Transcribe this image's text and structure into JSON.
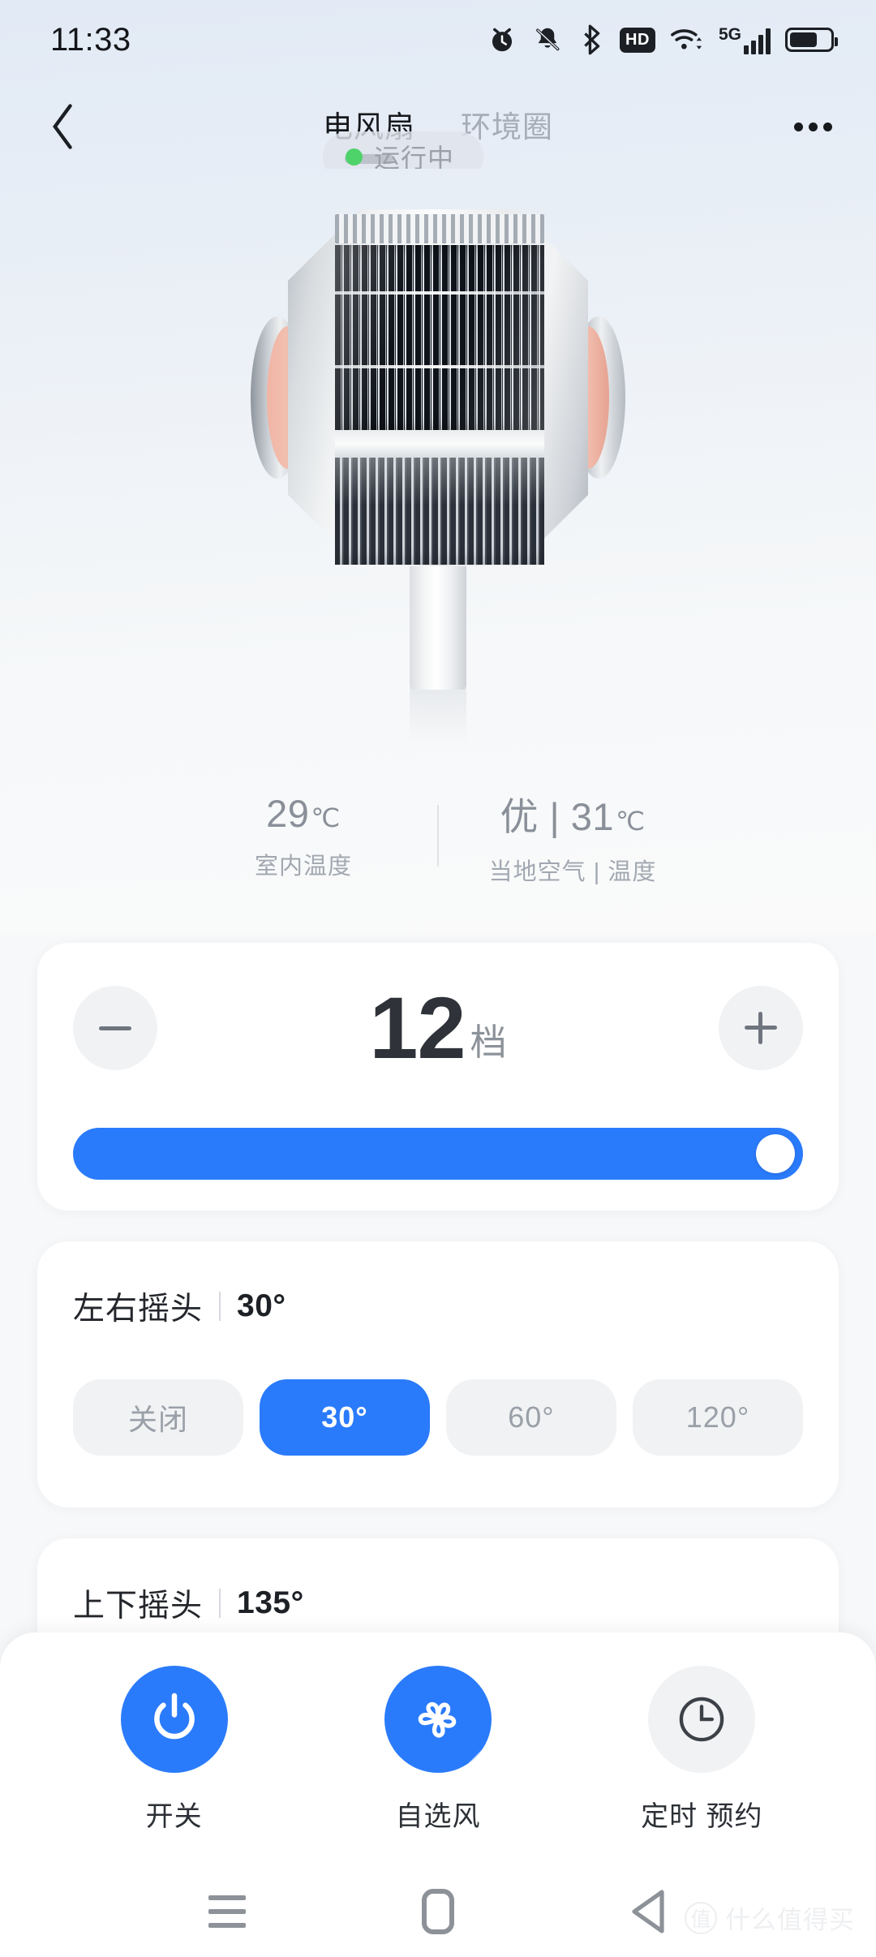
{
  "theme": {
    "accent": "#2a7bfb",
    "accent_soft": "#a8c8fb",
    "status_dot": "#4ed36a",
    "card_bg": "#ffffff",
    "chip_bg": "#f1f2f4",
    "text_primary": "#23262b",
    "text_muted": "#9aa0a8",
    "bg_top": "#e2eaf5",
    "bg_bottom": "#f7f8f9"
  },
  "status_bar": {
    "time": "11:33",
    "icons": [
      {
        "name": "alarm-clock-icon"
      },
      {
        "name": "bell-muted-icon"
      },
      {
        "name": "bluetooth-icon"
      },
      {
        "name": "hd-badge-icon",
        "label": "HD"
      },
      {
        "name": "wifi-icon"
      },
      {
        "name": "signal-5g-icon",
        "label": "5G"
      },
      {
        "name": "battery-icon",
        "level_percent": 68
      }
    ]
  },
  "header": {
    "back_label": "‹",
    "tabs": [
      {
        "label": "电风扇",
        "active": true
      },
      {
        "label": "环境圈",
        "active": false
      }
    ],
    "status_pill": {
      "text": "运行中",
      "dot_color": "#4ed36a"
    },
    "more_label": "•••"
  },
  "hero": {
    "device_name": "electric-fan-illustration"
  },
  "readouts": [
    {
      "value": "29",
      "unit": "℃",
      "label": "室内温度"
    },
    {
      "value": "优 | 31",
      "unit": "℃",
      "label": "当地空气 | 温度"
    }
  ],
  "speed_card": {
    "decrease_label": "−",
    "increase_label": "+",
    "value": "12",
    "suffix": "档",
    "slider": {
      "value": 12,
      "min": 1,
      "max": 12,
      "fill_percent": 100
    }
  },
  "horizontal_swing": {
    "title": "左右摇头",
    "value": "30°",
    "options": [
      {
        "label": "关闭",
        "selected": false
      },
      {
        "label": "30°",
        "selected": true
      },
      {
        "label": "60°",
        "selected": false
      },
      {
        "label": "120°",
        "selected": false
      }
    ]
  },
  "vertical_swing": {
    "title": "上下摇头",
    "value": "135°"
  },
  "action_bar": [
    {
      "label": "开关",
      "icon": "power-icon",
      "state": "on",
      "has_corner_tag": false
    },
    {
      "label": "自选风",
      "icon": "fan-blades-icon",
      "state": "on",
      "has_corner_tag": true
    },
    {
      "label": "定时 预约",
      "icon": "clock-icon",
      "state": "off",
      "has_corner_tag": false
    }
  ],
  "nav_bar": [
    {
      "name": "recents",
      "icon": "menu-lines-icon"
    },
    {
      "name": "home",
      "icon": "home-square-icon"
    },
    {
      "name": "back",
      "icon": "triangle-back-icon"
    }
  ],
  "watermark": {
    "mark": "值",
    "text": "什么值得买"
  }
}
